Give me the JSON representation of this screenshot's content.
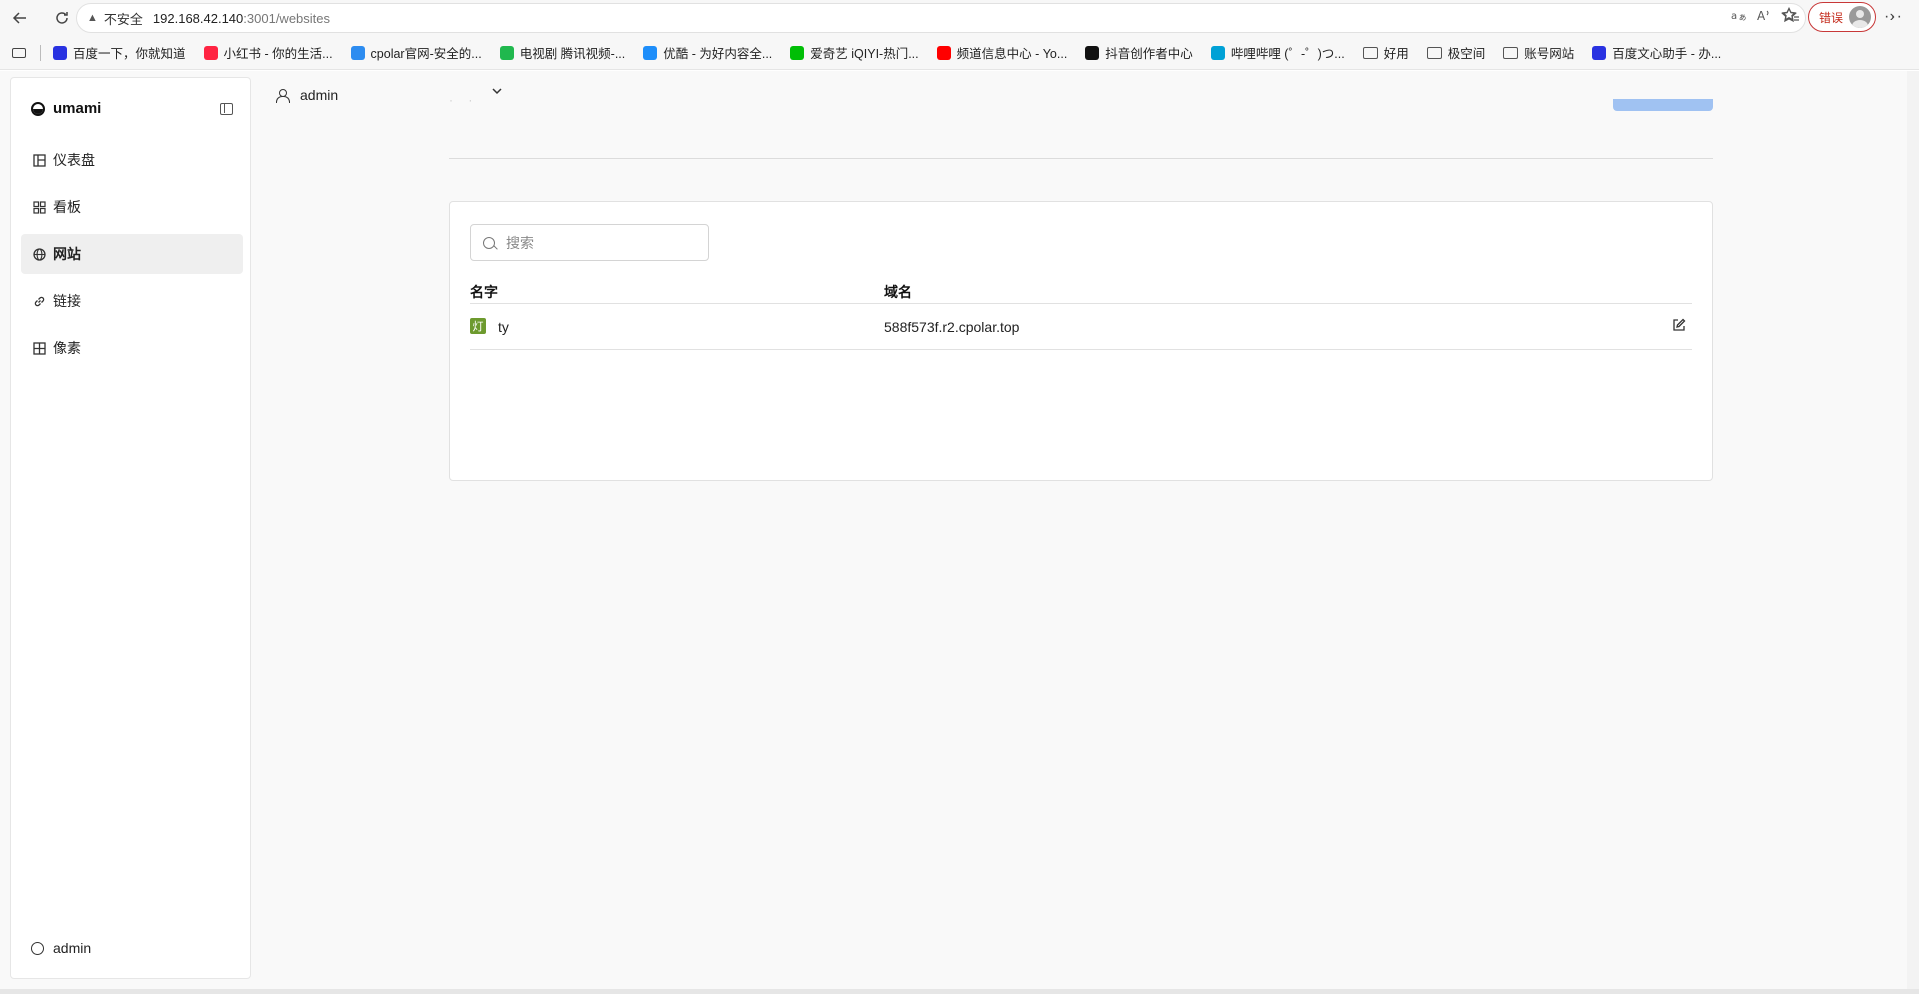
{
  "browser": {
    "address": {
      "security_label": "不安全",
      "host": "192.168.42.140",
      "path": ":3001/websites"
    },
    "profile_error_label": "错误",
    "icons": [
      "back-icon",
      "reload-icon",
      "warning-icon",
      "translate-icon",
      "read-aloud-icon",
      "favorite-star-icon",
      "favorites-icon",
      "more-icon"
    ],
    "bookmarks": [
      {
        "label": "百度一下，你就知道",
        "icon": "baidu-icon",
        "color": "#2932e1"
      },
      {
        "label": "小红书 - 你的生活...",
        "icon": "xiaohongshu-icon",
        "color": "#ff2442"
      },
      {
        "label": "cpolar官网-安全的...",
        "icon": "cpolar-icon",
        "color": "#2d8cf0"
      },
      {
        "label": "电视剧 腾讯视频-...",
        "icon": "tencent-video-icon",
        "color": "#20b84e"
      },
      {
        "label": "优酷 - 为好内容全...",
        "icon": "youku-icon",
        "color": "#1e8efa"
      },
      {
        "label": "爱奇艺 iQIYI-热门...",
        "icon": "iqiyi-icon",
        "color": "#00be06"
      },
      {
        "label": "频道信息中心 - Yo...",
        "icon": "youtube-icon",
        "color": "#ff0000"
      },
      {
        "label": "抖音创作者中心",
        "icon": "douyin-icon",
        "color": "#111111"
      },
      {
        "label": "哔哩哔哩 (゜-゜)つ...",
        "icon": "bilibili-icon",
        "color": "#00a1d6"
      },
      {
        "label": "好用",
        "icon": "folder-icon",
        "color": "#555555"
      },
      {
        "label": "极空间",
        "icon": "folder-icon",
        "color": "#555555"
      },
      {
        "label": "账号网站",
        "icon": "folder-icon",
        "color": "#555555"
      },
      {
        "label": "百度文心助手 - 办...",
        "icon": "baidu-icon",
        "color": "#2932e1"
      }
    ]
  },
  "app": {
    "brand": "umami",
    "nav": [
      {
        "label": "仪表盘",
        "icon": "dashboard-icon",
        "active": false
      },
      {
        "label": "看板",
        "icon": "boards-icon",
        "active": false
      },
      {
        "label": "网站",
        "icon": "globe-icon",
        "active": true
      },
      {
        "label": "链接",
        "icon": "link-icon",
        "active": false
      },
      {
        "label": "像素",
        "icon": "pixel-grid-icon",
        "active": false
      }
    ],
    "sidebar_user": "admin",
    "top_user": "admin",
    "search": {
      "placeholder": "搜索",
      "value": ""
    },
    "table": {
      "columns": [
        "名字",
        "域名"
      ],
      "rows": [
        {
          "name": "ty",
          "domain": "588f573f.r2.cpolar.top",
          "favicon": "灯"
        }
      ]
    },
    "colors": {
      "active_nav_bg": "#efefef",
      "primary_button": "#2680eb",
      "site_favicon_bg": "#6d9a2e"
    }
  }
}
